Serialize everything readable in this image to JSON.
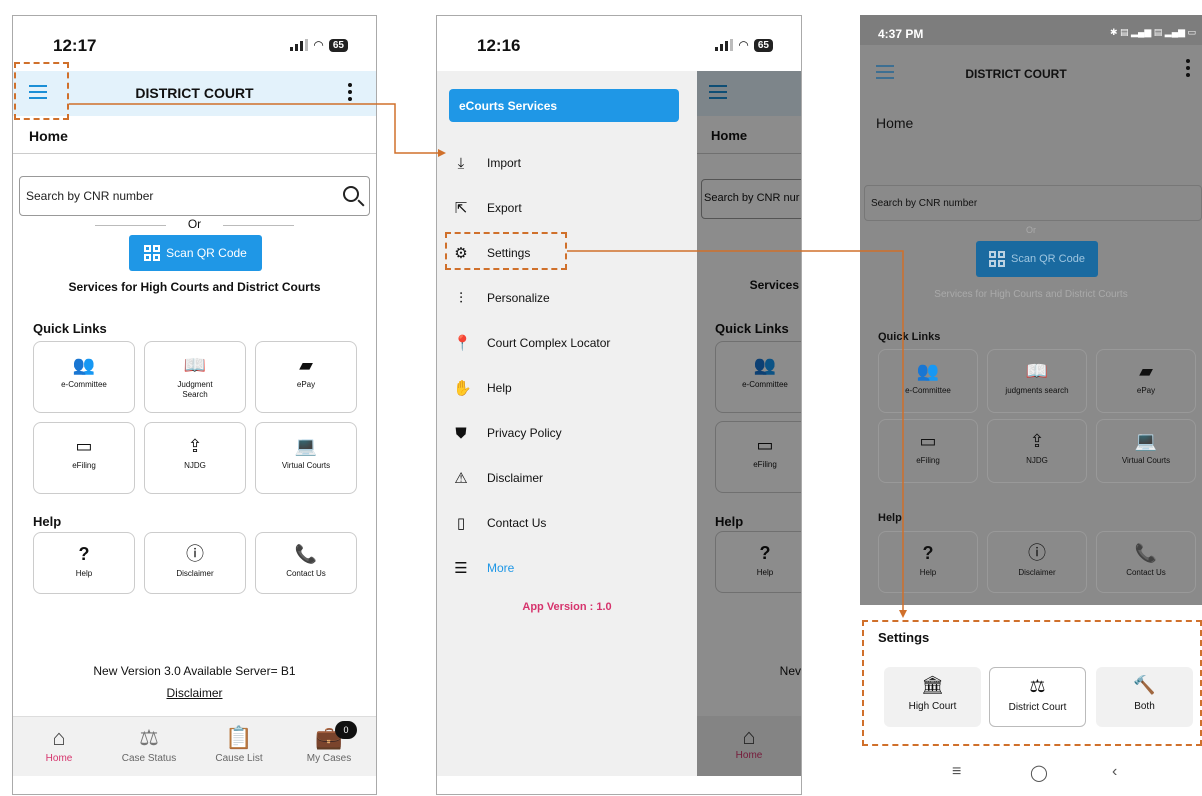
{
  "screen1": {
    "status": {
      "time": "12:17",
      "battery": "65"
    },
    "app_title": "DISTRICT COURT",
    "home_label": "Home",
    "search_placeholder": "Search by CNR number",
    "or_text": "Or",
    "scan_qr_label": "Scan QR Code",
    "services_heading": "Services for High Courts and District Courts",
    "quick_links_heading": "Quick Links",
    "quick_links": [
      {
        "label": "e-Committee",
        "icon": "people-icon"
      },
      {
        "label": "Judgment\nSearch",
        "icon": "book-icon"
      },
      {
        "label": "ePay",
        "icon": "wallet-icon"
      },
      {
        "label": "eFiling",
        "icon": "window-icon"
      },
      {
        "label": "NJDG",
        "icon": "upload-icon"
      },
      {
        "label": "Virtual Courts",
        "icon": "laptop-icon"
      }
    ],
    "help_heading": "Help",
    "help_links": [
      {
        "label": "Help",
        "icon": "question-icon"
      },
      {
        "label": "Disclaimer",
        "icon": "info-icon"
      },
      {
        "label": "Contact Us",
        "icon": "phone-icon"
      }
    ],
    "version_text": "New Version 3.0 Available Server= B1",
    "disclaimer_link": "Disclaimer",
    "bottom_nav": [
      {
        "label": "Home",
        "icon": "home-icon",
        "active": true
      },
      {
        "label": "Case Status",
        "icon": "scales-icon"
      },
      {
        "label": "Cause List",
        "icon": "clipboard-icon"
      },
      {
        "label": "My Cases",
        "icon": "briefcase-icon",
        "badge": "0"
      }
    ]
  },
  "screen2": {
    "status": {
      "time": "12:16",
      "battery": "65"
    },
    "drawer_header": "eCourts Services",
    "menu_items": [
      {
        "label": "Import",
        "icon": "download-icon"
      },
      {
        "label": "Export",
        "icon": "share-icon"
      },
      {
        "label": "Settings",
        "icon": "gear-icon"
      },
      {
        "label": "Personalize",
        "icon": "sliders-icon"
      },
      {
        "label": "Court Complex Locator",
        "icon": "pin-icon"
      },
      {
        "label": "Help",
        "icon": "hand-icon"
      },
      {
        "label": "Privacy Policy",
        "icon": "shield-icon"
      },
      {
        "label": "Disclaimer",
        "icon": "warning-icon"
      },
      {
        "label": "Contact Us",
        "icon": "mobile-icon"
      },
      {
        "label": "More",
        "icon": "list-icon"
      }
    ],
    "app_version": "App Version : 1.0",
    "underlay": {
      "home_label": "Home",
      "search_placeholder": "Search by CNR nur",
      "services_fragment": "Services",
      "quick_links_heading": "Quick Links",
      "tile1": "e-Committee",
      "tile2": "eFiling",
      "help_heading": "Help",
      "help_tile": "Help",
      "new_fragment": "Nev",
      "nav_home": "Home"
    }
  },
  "screen3": {
    "status": {
      "time": "4:37 PM"
    },
    "app_title": "DISTRICT COURT",
    "home_label": "Home",
    "search_placeholder": "Search by CNR number",
    "or_text": "Or",
    "scan_qr_label": "Scan QR Code",
    "services_heading": "Services for High Courts and District Courts",
    "quick_links_heading": "Quick Links",
    "quick_links": [
      {
        "label": "e-Committee",
        "icon": "people-icon"
      },
      {
        "label": "judgments search",
        "icon": "book-icon"
      },
      {
        "label": "ePay",
        "icon": "wallet-icon"
      },
      {
        "label": "eFiling",
        "icon": "window-icon"
      },
      {
        "label": "NJDG",
        "icon": "upload-icon"
      },
      {
        "label": "Virtual Courts",
        "icon": "laptop-icon"
      }
    ],
    "help_heading": "Help",
    "help_links": [
      {
        "label": "Help",
        "icon": "question-icon"
      },
      {
        "label": "Disclaimer",
        "icon": "info-icon"
      },
      {
        "label": "Contact Us",
        "icon": "phone-icon"
      }
    ],
    "settings_sheet": {
      "title": "Settings",
      "options": [
        {
          "label": "High Court",
          "icon": "courthouse-icon"
        },
        {
          "label": "District Court",
          "icon": "scales-icon",
          "selected": true
        },
        {
          "label": "Both",
          "icon": "gavel-icon"
        }
      ]
    }
  },
  "colors": {
    "accent": "#1f97e6",
    "appbar": "#e3f2fb",
    "annotation": "#d0702b",
    "version": "#d6336c"
  }
}
